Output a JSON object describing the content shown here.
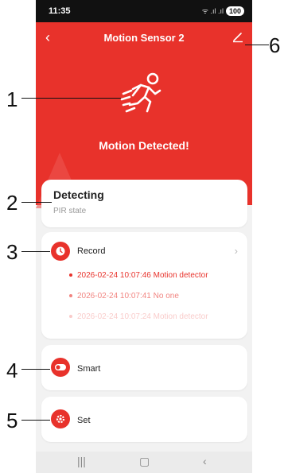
{
  "statusbar": {
    "time": "11:35",
    "signal": "ᯤ .ıl .ıl",
    "battery": "100"
  },
  "header": {
    "title": "Motion Sensor 2",
    "back": "‹"
  },
  "hero": {
    "status": "Motion Detected!"
  },
  "pir": {
    "state": "Detecting",
    "label": "PIR state"
  },
  "record": {
    "label": "Record",
    "logs": [
      {
        "text": "2026-02-24 10:07:46 Motion detector",
        "opacity": 1.0
      },
      {
        "text": "2026-02-24 10:07:41 No one",
        "opacity": 0.6
      },
      {
        "text": "2026-02-24 10:07:24 Motion detector",
        "opacity": 0.25
      }
    ]
  },
  "smart": {
    "label": "Smart"
  },
  "set": {
    "label": "Set"
  },
  "callouts": [
    "1",
    "2",
    "3",
    "4",
    "5",
    "6"
  ],
  "colors": {
    "accent": "#e8322b"
  }
}
